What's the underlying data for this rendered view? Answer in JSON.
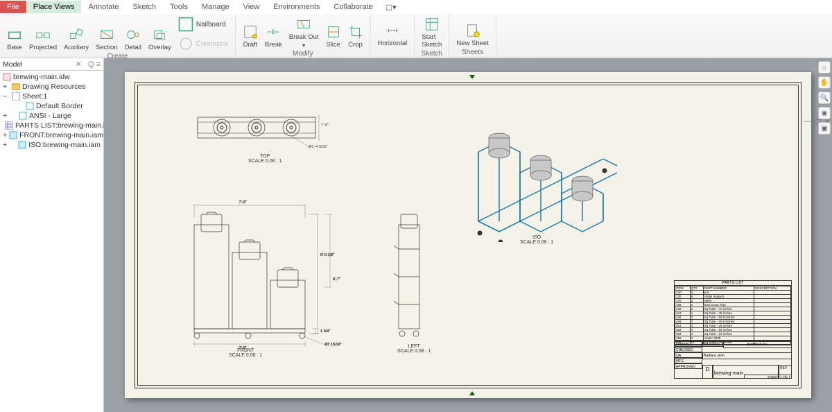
{
  "tabs": {
    "file": "File",
    "placeViews": "Place Views",
    "annotate": "Annotate",
    "sketch": "Sketch",
    "tools": "Tools",
    "manage": "Manage",
    "view": "View",
    "environments": "Environments",
    "collaborate": "Collaborate"
  },
  "ribbon": {
    "create": {
      "label": "Create",
      "items": [
        "Base",
        "Projected",
        "Auxiliary",
        "Section",
        "Detail",
        "Overlay"
      ],
      "side": [
        "Nailboard",
        "Connector"
      ]
    },
    "modify": {
      "label": "Modify",
      "items": [
        "Draft",
        "Break",
        "Break Out",
        "Slice",
        "Crop"
      ]
    },
    "dim": {
      "item": "Horizontal"
    },
    "sketch": {
      "label": "Sketch",
      "item": "Start Sketch"
    },
    "sheets": {
      "label": "Sheets",
      "item": "New Sheet"
    }
  },
  "browser": {
    "title": "Model",
    "root": "brewing-main.idw",
    "res": "Drawing Resources",
    "sheet": "Sheet:1",
    "children": [
      "Default Border",
      "ANSI - Large",
      "PARTS LIST:brewing-main.iam",
      "FRONT:brewing-main.iam",
      "ISO:brewing-main.iam"
    ]
  },
  "views": {
    "top": {
      "name": "TOP",
      "scale": "SCALE 0.08 : 1",
      "dims": [
        "7'-0\"",
        "Ø1'-4 3/16\""
      ]
    },
    "front": {
      "name": "FRONT",
      "scale": "SCALE 0.08 : 1",
      "dims": [
        "7'-0\"",
        "6'-0 1/2\"",
        "6'-7\"",
        "1 3/4\"",
        "Ø3 15/16\""
      ]
    },
    "left": {
      "name": "LEFT",
      "scale": "SCALE 0.08 : 1"
    },
    "iso": {
      "name": "ISO",
      "scale": "SCALE 0.08 : 1"
    }
  },
  "partsList": {
    "title": "PARTS LIST",
    "headers": [
      "ITEM",
      "QTY",
      "PART NUMBER",
      "DESCRIPTION"
    ],
    "rows": [
      [
        "120",
        "3",
        "pot",
        ""
      ],
      [
        "130",
        "6",
        "Angle Support",
        ""
      ],
      [
        "170",
        "3",
        "valve",
        ""
      ],
      [
        "198",
        "4",
        "End Cross Tray",
        ""
      ],
      [
        "440",
        "2",
        "Sq Tube - 72 inches",
        ""
      ],
      [
        "441",
        "4",
        "Sq Tube - 48 inches",
        ""
      ],
      [
        "445",
        "2",
        "Sq Tube - 50.5 inches",
        ""
      ],
      [
        "446",
        "4",
        "Sq Tube - 26.5 inches",
        ""
      ],
      [
        "451",
        "3",
        "Sq Tube - 26 inches",
        ""
      ],
      [
        "453",
        "4",
        "Sq Tube - 22 inches",
        ""
      ],
      [
        "454",
        "4",
        "Sq Tube - 24 inches",
        ""
      ],
      [
        "456",
        "4",
        "caster 3338",
        ""
      ],
      [
        "465",
        "10",
        "Sq Tube - 24 inches",
        ""
      ]
    ]
  },
  "titleBlock": {
    "drawn": "DRAWN",
    "checked": "CHECKED",
    "qa": "QA",
    "mfg": "MFG",
    "approved": "APPROVED",
    "date": "3/13/2015",
    "company": "Autodesk Inc.",
    "title": "",
    "dwgNo": "brewing-main",
    "size": "D",
    "rev": "",
    "sheet": "SHEET 1 OF 1",
    "designer": "Barbara Jerin"
  }
}
